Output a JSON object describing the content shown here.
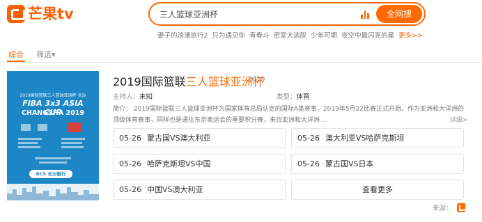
{
  "header": {
    "logo_text": "芒果tv",
    "search": {
      "value": "三人篮球亚洲杯",
      "button_label": "全网搜"
    },
    "hot_searches": [
      "妻子的浪漫旅行2",
      "只为遇见你",
      "青春斗",
      "密室大逃脱",
      "少年可期",
      "夜空中最闪亮的星"
    ],
    "hot_more": "更多>>"
  },
  "filters": {
    "all_label": "综合",
    "select_label": "筛选▾"
  },
  "poster": {
    "line1": "2019国际篮联三人篮球亚洲杯·长沙",
    "line2": "FIBA 3x3 ASIA CUP",
    "line3": "CHANGSHA 2019",
    "logo": "BCS 长沙银行"
  },
  "result": {
    "title_prefix": "2019国际篮联",
    "title_highlight": "三人篮球亚洲杯",
    "year": "2019",
    "host_label": "主持人：",
    "host_value": "未知",
    "type_label": "类型：",
    "type_value": "体育",
    "intro": "简介： 2019国际篮联三人篮球亚洲杯为国家体育总局认定的国际A类赛事，2019年5月22比赛正式开始。作为亚洲和大洋洲的顶级体育赛事，同样也是通往东京奥运会的重要积分赛，来自亚洲和大洋洲 ...",
    "detail_link": "详细>",
    "episodes": [
      {
        "date": "05-26",
        "name": "蒙古国VS澳大利亚"
      },
      {
        "date": "05-26",
        "name": "澳大利亚VS哈萨克斯坦"
      },
      {
        "date": "05-26",
        "name": "哈萨克斯坦VS中国"
      },
      {
        "date": "05-26",
        "name": "蒙古国VS日本"
      },
      {
        "date": "05-26",
        "name": "中国VS澳大利亚"
      }
    ],
    "more_label": "查看更多",
    "source_label": "来源："
  },
  "colors": {
    "accent": "#ff6a00",
    "poster_bg": "#1d86c4"
  }
}
